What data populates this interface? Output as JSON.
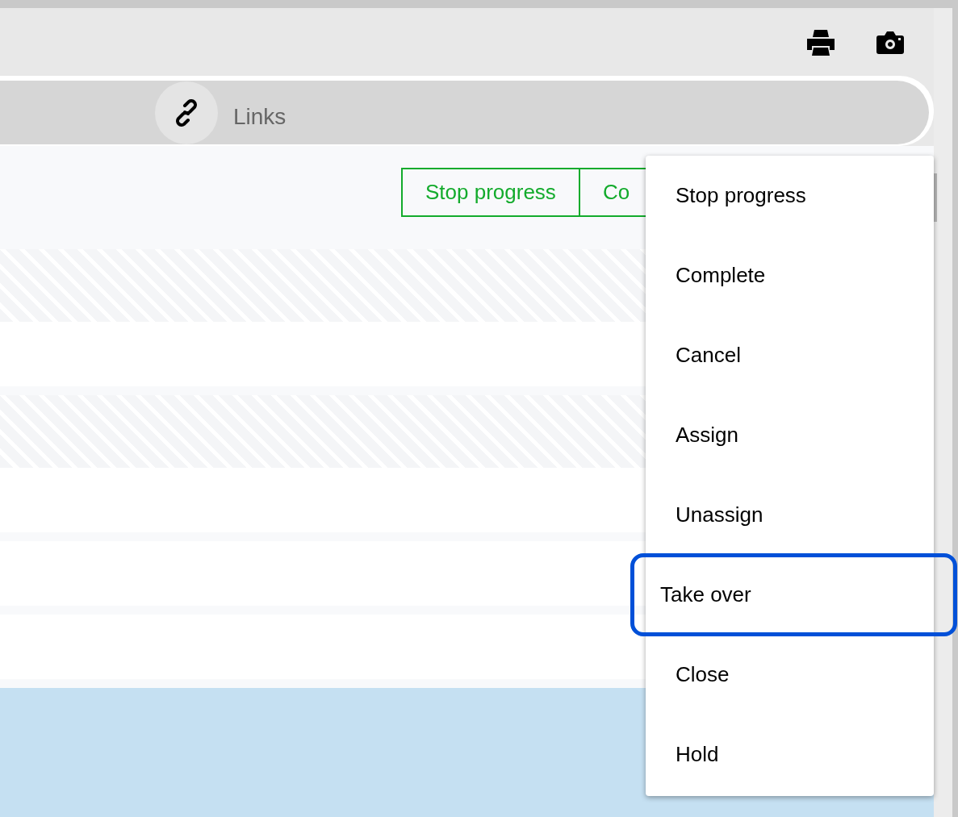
{
  "tab": {
    "label": "Links"
  },
  "buttons": [
    "Stop progress",
    "Co"
  ],
  "rows": [
    {
      "kind": "striped"
    },
    {
      "kind": "plain"
    },
    {
      "kind": "striped"
    },
    {
      "kind": "plain"
    },
    {
      "kind": "plain"
    },
    {
      "kind": "plain"
    },
    {
      "kind": "highlighted"
    }
  ],
  "menu": [
    {
      "label": "Stop progress",
      "selected": false
    },
    {
      "label": "Complete",
      "selected": false
    },
    {
      "label": "Cancel",
      "selected": false
    },
    {
      "label": "Assign",
      "selected": false
    },
    {
      "label": "Unassign",
      "selected": false
    },
    {
      "label": "Take over",
      "selected": true
    },
    {
      "label": "Close",
      "selected": false
    },
    {
      "label": "Hold",
      "selected": false
    }
  ]
}
